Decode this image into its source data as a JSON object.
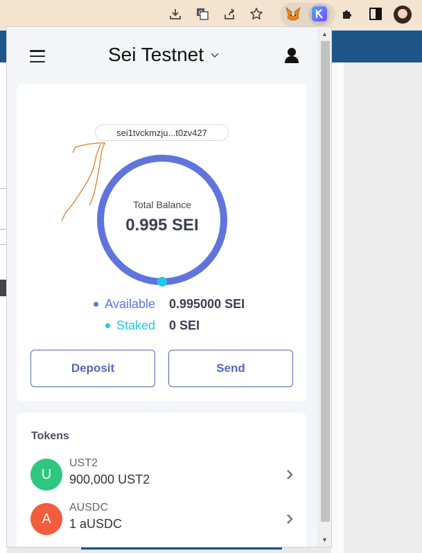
{
  "popup": {
    "network": "Sei Testnet",
    "address": "sei1tvckmzju...t0zv427",
    "balance": {
      "label": "Total Balance",
      "value": "0.995 SEI",
      "available_label": "Available",
      "available_value": "0.995000 SEI",
      "staked_label": "Staked",
      "staked_value": "0 SEI",
      "available_fraction": 1.0,
      "staked_fraction": 0.0
    },
    "actions": {
      "deposit": "Deposit",
      "send": "Send"
    },
    "tokens": {
      "title": "Tokens",
      "items": [
        {
          "initial": "U",
          "symbol": "UST2",
          "amount": "900,000 UST2",
          "color": "#2fc67f"
        },
        {
          "initial": "A",
          "symbol": "AUSDC",
          "amount": "1 aUSDC",
          "color": "#f35c3c"
        }
      ]
    }
  },
  "colors": {
    "available": "#5f75dd",
    "staked": "#22c9e6",
    "accent": "#5567b8",
    "annotation": "#d9741c"
  },
  "icons": {
    "toolbar": [
      "download-icon",
      "translate-icon",
      "share-icon",
      "bookmark-star-icon",
      "metamask-fox-icon",
      "keplr-k-icon",
      "puzzle-extensions-icon",
      "side-panel-icon",
      "profile-avatar"
    ],
    "popup": [
      "hamburger-menu-icon",
      "chevron-down-icon",
      "user-icon",
      "chevron-right-icon"
    ]
  }
}
